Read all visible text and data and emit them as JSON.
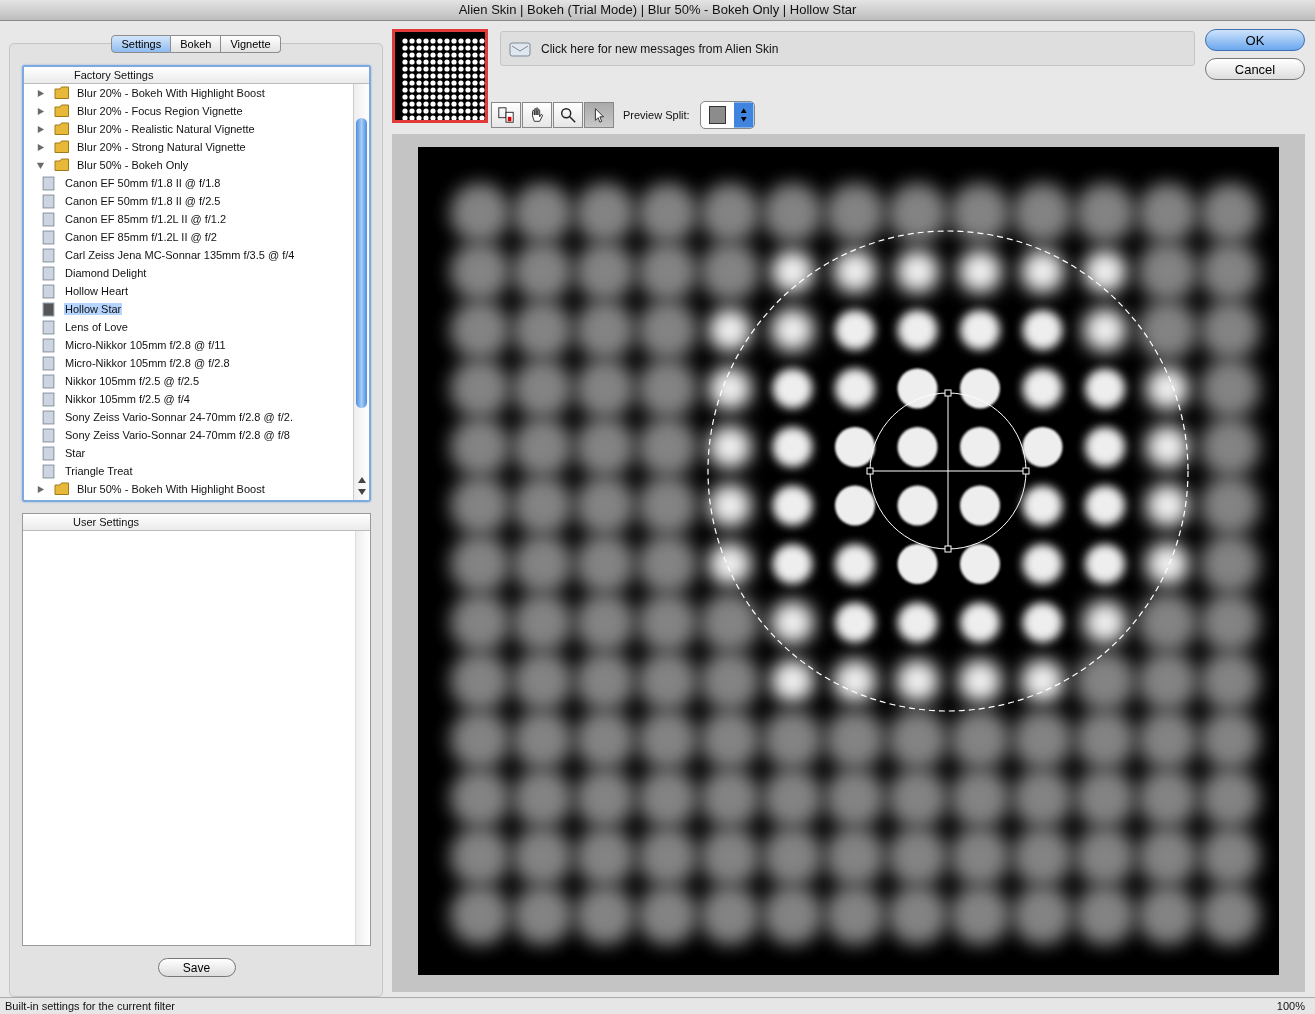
{
  "window": {
    "title": "Alien Skin | Bokeh (Trial Mode) | Blur 50% - Bokeh Only | Hollow Star"
  },
  "tabs": [
    {
      "label": "Settings",
      "selected": true
    },
    {
      "label": "Bokeh",
      "selected": false
    },
    {
      "label": "Vignette",
      "selected": false
    }
  ],
  "factory_settings": {
    "header": "Factory Settings",
    "items": [
      {
        "label": "Blur 20% - Bokeh With Highlight Boost",
        "kind": "folder",
        "expanded": false
      },
      {
        "label": "Blur 20% - Focus Region Vignette",
        "kind": "folder",
        "expanded": false
      },
      {
        "label": "Blur 20% - Realistic Natural Vignette",
        "kind": "folder",
        "expanded": false
      },
      {
        "label": "Blur 20% - Strong Natural Vignette",
        "kind": "folder",
        "expanded": false
      },
      {
        "label": "Blur 50% - Bokeh Only",
        "kind": "folder",
        "expanded": true,
        "children": [
          {
            "label": "Canon EF 50mm f/1.8 II @ f/1.8",
            "kind": "preset",
            "selected": false
          },
          {
            "label": "Canon EF 50mm f/1.8 II @ f/2.5",
            "kind": "preset",
            "selected": false
          },
          {
            "label": "Canon EF 85mm f/1.2L II @ f/1.2",
            "kind": "preset",
            "selected": false
          },
          {
            "label": "Canon EF 85mm f/1.2L II @ f/2",
            "kind": "preset",
            "selected": false
          },
          {
            "label": "Carl Zeiss Jena MC-Sonnar 135mm f/3.5 @ f/4",
            "kind": "preset",
            "selected": false
          },
          {
            "label": "Diamond Delight",
            "kind": "preset",
            "selected": false
          },
          {
            "label": "Hollow Heart",
            "kind": "preset",
            "selected": false
          },
          {
            "label": "Hollow Star",
            "kind": "preset",
            "selected": true
          },
          {
            "label": "Lens of Love",
            "kind": "preset",
            "selected": false
          },
          {
            "label": "Micro-Nikkor 105mm f/2.8 @ f/11",
            "kind": "preset",
            "selected": false
          },
          {
            "label": "Micro-Nikkor 105mm f/2.8 @ f/2.8",
            "kind": "preset",
            "selected": false
          },
          {
            "label": "Nikkor 105mm f/2.5 @ f/2.5",
            "kind": "preset",
            "selected": false
          },
          {
            "label": "Nikkor 105mm f/2.5 @ f/4",
            "kind": "preset",
            "selected": false
          },
          {
            "label": "Sony Zeiss Vario-Sonnar 24-70mm f/2.8 @ f/2.",
            "kind": "preset",
            "selected": false
          },
          {
            "label": "Sony Zeiss Vario-Sonnar 24-70mm f/2.8 @ f/8",
            "kind": "preset",
            "selected": false
          },
          {
            "label": "Star",
            "kind": "preset",
            "selected": false
          },
          {
            "label": "Triangle Treat",
            "kind": "preset",
            "selected": false
          }
        ]
      },
      {
        "label": "Blur 50% - Bokeh With Highlight Boost",
        "kind": "folder",
        "expanded": false
      }
    ]
  },
  "user_settings": {
    "header": "User Settings"
  },
  "save_button": "Save",
  "message": "Click here for new messages from Alien Skin",
  "ok_button": "OK",
  "cancel_button": "Cancel",
  "tools": [
    {
      "kind": "compare",
      "selected": false
    },
    {
      "kind": "hand",
      "selected": false
    },
    {
      "kind": "zoom",
      "selected": false
    },
    {
      "kind": "pointer",
      "selected": true
    }
  ],
  "preview_split": {
    "label": "Preview Split:"
  },
  "status_bar": {
    "text": "Built-in settings for the current filter",
    "zoom": "100%"
  }
}
